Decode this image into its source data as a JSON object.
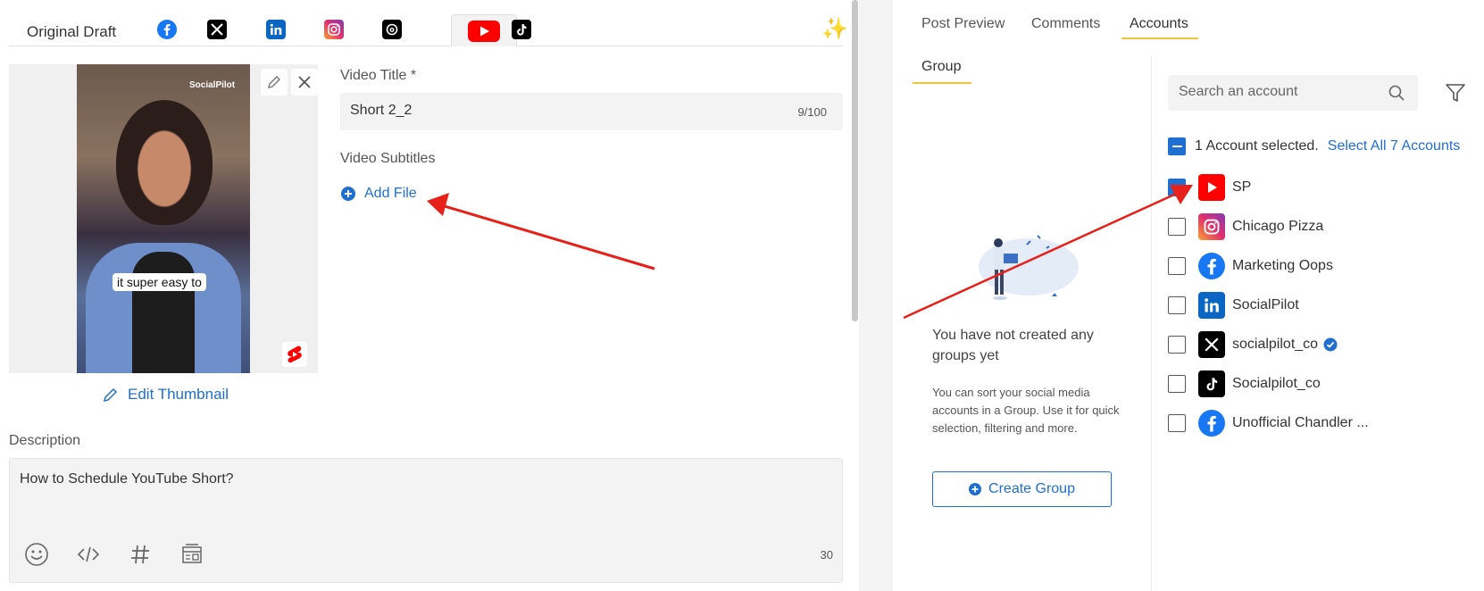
{
  "editor": {
    "tabs": {
      "original": "Original Draft",
      "networks": [
        "facebook",
        "x",
        "linkedin",
        "instagram",
        "threads",
        "youtube",
        "tiktok"
      ],
      "active": "youtube"
    },
    "media": {
      "caption": "it super easy to",
      "watermark": "SocialPilot"
    },
    "edit_thumbnail_label": "Edit Thumbnail",
    "video_title": {
      "label": "Video Title *",
      "value": "Short 2_2",
      "count": "9/100"
    },
    "video_subtitles": {
      "label": "Video Subtitles",
      "add_file_label": "Add File"
    },
    "description": {
      "label": "Description",
      "value": "How to Schedule YouTube Short?",
      "char_count": "30"
    }
  },
  "panel": {
    "tabs": [
      "Post Preview",
      "Comments",
      "Accounts"
    ],
    "active_tab": "Accounts",
    "group": {
      "tab_label": "Group",
      "empty_title": "You have not created any groups yet",
      "empty_desc": "You can sort your social media accounts in a Group. Use it for quick selection, filtering and more.",
      "create_label": "Create Group"
    },
    "search": {
      "placeholder": "Search an account"
    },
    "selection": {
      "summary": "1 Account selected.",
      "select_all": "Select All 7 Accounts"
    },
    "accounts": [
      {
        "name": "SP",
        "network": "youtube",
        "checked": true
      },
      {
        "name": "Chicago Pizza",
        "network": "instagram",
        "checked": false
      },
      {
        "name": "Marketing Oops",
        "network": "facebook",
        "checked": false
      },
      {
        "name": "SocialPilot",
        "network": "linkedin",
        "checked": false
      },
      {
        "name": "socialpilot_co",
        "network": "x",
        "checked": false,
        "verified": true
      },
      {
        "name": "Socialpilot_co",
        "network": "tiktok",
        "checked": false
      },
      {
        "name": "Unofficial Chandler ...",
        "network": "facebook",
        "checked": false
      }
    ]
  },
  "colors": {
    "accent": "#1f6fd0",
    "tab_underline": "#f0c640",
    "annotation_arrow": "#e8201a"
  }
}
